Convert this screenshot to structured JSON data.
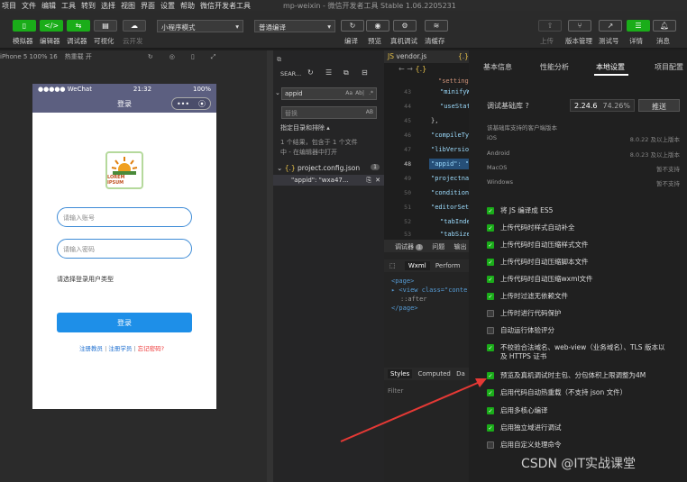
{
  "menubar": {
    "items": [
      "项目",
      "文件",
      "编辑",
      "工具",
      "转到",
      "选择",
      "视图",
      "界面",
      "设置",
      "帮助",
      "微信开发者工具"
    ],
    "title": "mp-weixin - 微信开发者工具 Stable 1.06.2205231"
  },
  "toolbar": {
    "left_labels": [
      "模拟器",
      "编辑器",
      "调试器",
      "可视化",
      "云开发"
    ],
    "mode_select": "小程序模式",
    "compile_select": "普通编译",
    "mid_labels": [
      "编译",
      "预览",
      "真机调试",
      "清缓存"
    ],
    "right_labels": [
      "上传",
      "版本管理",
      "测试号",
      "详情",
      "消息"
    ]
  },
  "simulator": {
    "device": "iPhone 5 100% 16",
    "hotreload": "热重载 开",
    "status_carrier": "●●●●● WeChat",
    "status_time": "21:32",
    "status_battery": "100%",
    "nav_title": "登录",
    "logo_text": "LOREM IPSUM",
    "username_placeholder": "请输入账号",
    "password_placeholder": "请输入密码",
    "user_type": "请选择登录用户类型",
    "login_button": "登录",
    "link_register": "注册教员",
    "link_student": "注册学员",
    "link_forgot": "忘记密码?",
    "link_sep": " | "
  },
  "explorer": {
    "header": "SEAR...",
    "search_value": "appid",
    "search_opt1": "Aa",
    "search_opt2": "Ab|",
    "search_opt3": ".*",
    "replace_placeholder": "替换",
    "replace_opt": "AB",
    "scope": "指定目录和排除 ▴",
    "result_line1": "1 个结果，包含于 1 个文件",
    "result_line2": "中 - 在编辑器中打开",
    "file": "project.config.json",
    "file_count": "1",
    "match": "\"appid\": \"wxa47..."
  },
  "editor": {
    "tab": "vendor.js",
    "lines": [
      {
        "num": "",
        "text": "\"setting\": {"
      },
      {
        "num": "43",
        "text": "\"minifyW"
      },
      {
        "num": "44",
        "text": "\"useStat"
      },
      {
        "num": "45",
        "text": "},"
      },
      {
        "num": "46",
        "text": "\"compileTy"
      },
      {
        "num": "47",
        "text": "\"libVersio"
      },
      {
        "num": "48",
        "text": "\"appid\": \""
      },
      {
        "num": "49",
        "text": "\"projectna"
      },
      {
        "num": "50",
        "text": "\"condition"
      },
      {
        "num": "51",
        "text": "\"editorSet"
      },
      {
        "num": "52",
        "text": "\"tabInde"
      },
      {
        "num": "53",
        "text": "\"tabSize"
      }
    ]
  },
  "devtools": {
    "tabs": [
      "调试器",
      "问题",
      "输出"
    ],
    "badge": "1",
    "subtabs": [
      "Wxml",
      "Perform"
    ],
    "tree": [
      "<page>",
      "▸ <view class=\"conte",
      "::after",
      "</page>"
    ],
    "style_tabs": [
      "Styles",
      "Computed",
      "Da"
    ],
    "filter": "Filter"
  },
  "panel": {
    "tabs": [
      "基本信息",
      "性能分析",
      "本地设置",
      "项目配置"
    ],
    "lib_label": "调试基础库",
    "lib_version": "2.24.6",
    "lib_percent": "74.26%",
    "push_button": "推送",
    "support_title": "该基础库支持的客户端版本",
    "platforms": [
      {
        "name": "iOS",
        "value": "8.0.22 及以上版本"
      },
      {
        "name": "Android",
        "value": "8.0.23 及以上版本"
      },
      {
        "name": "MacOS",
        "value": "暂不支持"
      },
      {
        "name": "Windows",
        "value": "暂不支持"
      }
    ],
    "options": [
      {
        "label": "将 JS 编译成 ES5",
        "checked": true
      },
      {
        "label": "上传代码时样式自动补全",
        "checked": true
      },
      {
        "label": "上传代码时自动压缩样式文件",
        "checked": true
      },
      {
        "label": "上传代码时自动压缩脚本文件",
        "checked": true
      },
      {
        "label": "上传代码时自动压缩wxml文件",
        "checked": true
      },
      {
        "label": "上传时过滤无依赖文件",
        "checked": true
      },
      {
        "label": "上传时进行代码保护",
        "checked": false
      },
      {
        "label": "自动运行体验评分",
        "checked": false
      },
      {
        "label": "不校验合法域名、web-view（业务域名）、TLS 版本以及 HTTPS 证书",
        "checked": true
      },
      {
        "label": "预览及真机调试时主包、分包体积上限调整为4M",
        "checked": true
      },
      {
        "label": "启用代码自动热重载（不支持 json 文件）",
        "checked": true
      },
      {
        "label": "启用多核心编译",
        "checked": true
      },
      {
        "label": "启用独立域进行调试",
        "checked": true
      },
      {
        "label": "启用自定义处理命令",
        "checked": false
      }
    ]
  },
  "watermark": "CSDN @IT实战课堂",
  "colors": {
    "accent": "#1aad19",
    "nav": "#5c5f80",
    "arrow": "#e53935",
    "link": "#1e6fd0"
  }
}
